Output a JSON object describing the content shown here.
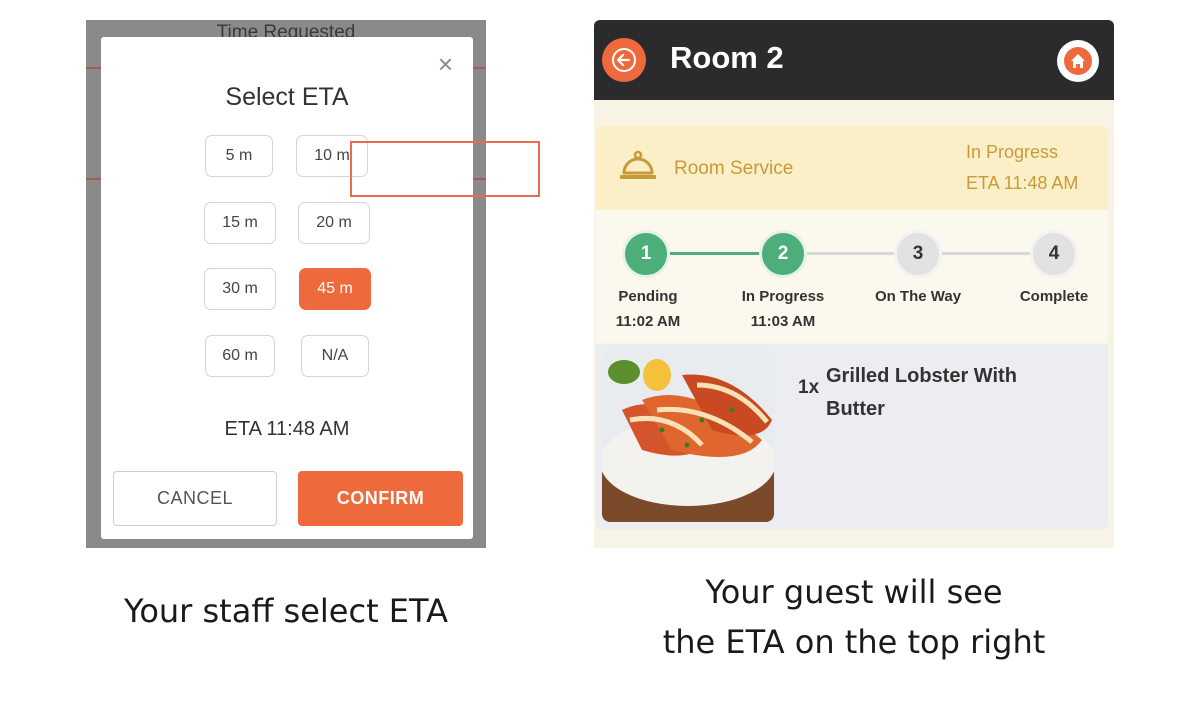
{
  "staff_panel": {
    "background_header": "Time Requested",
    "modal": {
      "title": "Select ETA",
      "close_symbol": "×",
      "options": [
        "5 m",
        "10 m",
        "15 m",
        "20 m",
        "30 m",
        "45 m",
        "60 m",
        "N/A"
      ],
      "selected_option": "45 m",
      "eta_value": "ETA 11:48 AM",
      "cancel_label": "CANCEL",
      "confirm_label": "CONFIRM"
    },
    "caption": "Your staff select ETA"
  },
  "guest_panel": {
    "header": {
      "title": "Room 2",
      "back_icon": "arrow-left-icon",
      "home_icon": "home-icon"
    },
    "status_card": {
      "service_icon": "cloche-icon",
      "service_label": "Room Service",
      "status": "In Progress",
      "eta": "ETA 11:48 AM"
    },
    "steps": [
      {
        "number": "1",
        "label": "Pending",
        "time": "11:02 AM",
        "done": true
      },
      {
        "number": "2",
        "label": "In Progress",
        "time": "11:03 AM",
        "done": true
      },
      {
        "number": "3",
        "label": "On The Way",
        "time": "",
        "done": false
      },
      {
        "number": "4",
        "label": "Complete",
        "time": "",
        "done": false
      }
    ],
    "order_item": {
      "quantity": "1x",
      "name": "Grilled Lobster With Butter"
    },
    "caption_line1": "Your guest will see",
    "caption_line2": "the ETA on the top right"
  },
  "colors": {
    "accent": "#ee6a3c",
    "header_dark": "#2b2b2d",
    "step_done": "#4caf7a",
    "status_gold": "#c99a3a",
    "highlight_border": "#e96c4f"
  }
}
